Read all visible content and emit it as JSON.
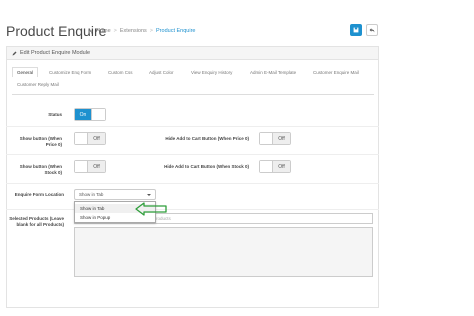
{
  "header": {
    "title": "Product Enquire",
    "breadcrumb": [
      "Home",
      "Extensions",
      "Product Enquire"
    ]
  },
  "panel": {
    "heading": "Edit Product Enquire Module"
  },
  "tabs": [
    {
      "label": "General",
      "active": true
    },
    {
      "label": "Customize Enq Form",
      "active": false
    },
    {
      "label": "Custom Css",
      "active": false
    },
    {
      "label": "Adjust Color",
      "active": false
    },
    {
      "label": "View Enquiry History",
      "active": false
    },
    {
      "label": "Admin E-Mail Template",
      "active": false
    },
    {
      "label": "Customer Enquire Mail",
      "active": false
    },
    {
      "label": "Customer Reply Mail",
      "active": false
    }
  ],
  "fields": {
    "status_label": "Status",
    "status_value": "On",
    "show_button_price_label": "Show button (When Price 0)",
    "show_button_price_value": "Off",
    "hide_cart_price_label": "Hide Add to Cart Button (When Price 0)",
    "hide_cart_price_value": "Off",
    "show_button_stock_label": "Show button (When Stock 0)",
    "show_button_stock_value": "Off",
    "hide_cart_stock_label": "Hide Add to Cart Button (When Stock 0)",
    "hide_cart_stock_value": "Off",
    "location_label": "Enquire Form Location",
    "location_value": "Show in Tab",
    "location_options": [
      "Show in Tab",
      "Show in Popup"
    ],
    "selected_products_label": "Selected Products (Leave blank for all Products)",
    "products_placeholder": "Products"
  },
  "colors": {
    "accent": "#1e91cf",
    "arrow": "#2e9e3a"
  }
}
